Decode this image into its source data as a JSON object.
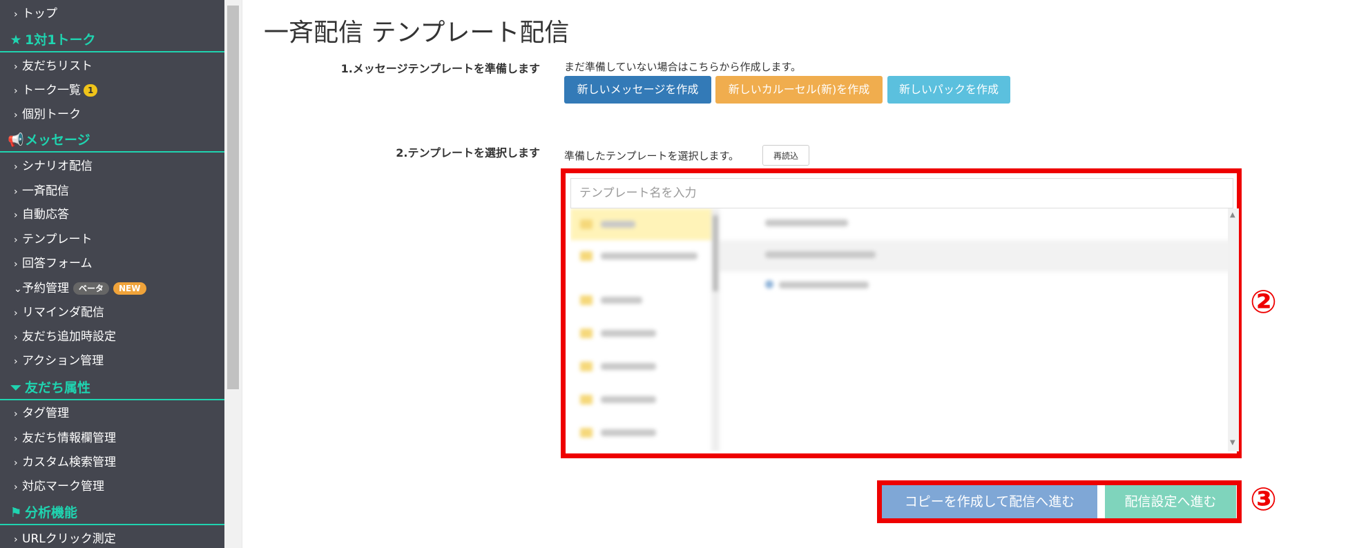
{
  "sidebar": {
    "top_item": "トップ",
    "sections": [
      {
        "title": "1対1トーク",
        "icon": "star-icon",
        "items": [
          {
            "label": "友だちリスト"
          },
          {
            "label": "トーク一覧",
            "badge": "1"
          },
          {
            "label": "個別トーク"
          }
        ]
      },
      {
        "title": "メッセージ",
        "icon": "megaphone-icon",
        "items": [
          {
            "label": "シナリオ配信"
          },
          {
            "label": "一斉配信"
          },
          {
            "label": "自動応答"
          },
          {
            "label": "テンプレート"
          },
          {
            "label": "回答フォーム"
          },
          {
            "label": "予約管理",
            "badge_beta": "ベータ",
            "badge_new": "NEW",
            "expanded": true
          },
          {
            "label": "リマインダ配信"
          },
          {
            "label": "友だち追加時設定"
          },
          {
            "label": "アクション管理"
          }
        ]
      },
      {
        "title": "友だち属性",
        "icon": "filter-icon",
        "items": [
          {
            "label": "タグ管理"
          },
          {
            "label": "友だち情報欄管理"
          },
          {
            "label": "カスタム検索管理"
          },
          {
            "label": "対応マーク管理"
          }
        ]
      },
      {
        "title": "分析機能",
        "icon": "flag-icon",
        "items": [
          {
            "label": "URLクリック測定"
          }
        ]
      }
    ]
  },
  "page": {
    "title": "一斉配信 テンプレート配信",
    "step1": {
      "label": "1.メッセージテンプレートを準備します",
      "help": "まだ準備していない場合はこちらから作成します。",
      "buttons": [
        "新しいメッセージを作成",
        "新しいカルーセル(新)を作成",
        "新しいパックを作成"
      ]
    },
    "step2": {
      "label": "2.テンプレートを選択します",
      "help": "準備したテンプレートを選択します。",
      "reload": "再読込",
      "search_placeholder": "テンプレート名を入力"
    },
    "actions": {
      "copy_button": "コピーを作成して配信へ進む",
      "next_button": "配信設定へ進む"
    },
    "markers": {
      "picker": "②",
      "actions": "③"
    }
  },
  "colors": {
    "sidebar_bg": "#44464f",
    "accent": "#1fd4b0",
    "btn_primary": "#337ab7",
    "btn_warning": "#f0ad4e",
    "btn_info": "#5bc0de",
    "btn_copy": "#7fa7d6",
    "btn_next": "#7fd4bc",
    "highlight_red": "#ee0000"
  }
}
